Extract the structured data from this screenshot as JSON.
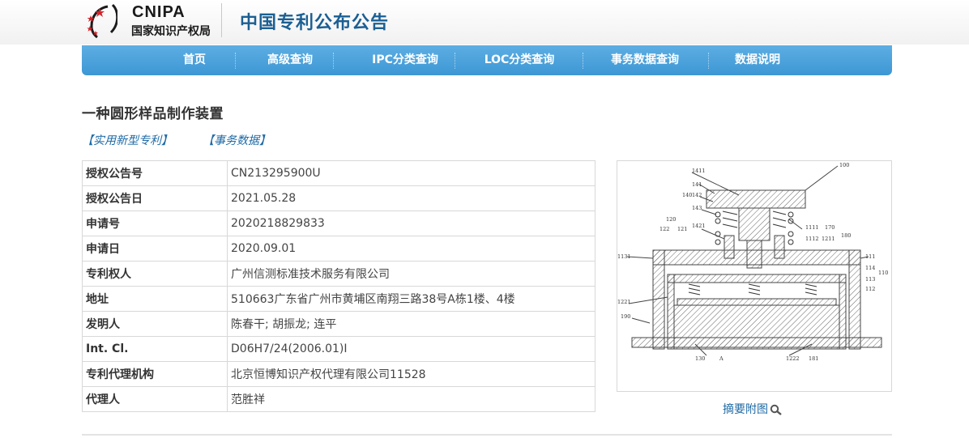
{
  "header": {
    "logo_text": "CNIPA",
    "logo_cn": "国家知识产权局",
    "site_title": "中国专利公布公告"
  },
  "nav": {
    "items": [
      "首页",
      "高级查询",
      "IPC分类查询",
      "LOC分类查询",
      "事务数据查询",
      "数据说明"
    ]
  },
  "patent": {
    "title": "一种圆形样品制作装置",
    "tags": [
      "【实用新型专利】",
      "【事务数据】"
    ],
    "fields": [
      {
        "label": "授权公告号",
        "value": "CN213295900U"
      },
      {
        "label": "授权公告日",
        "value": "2021.05.28"
      },
      {
        "label": "申请号",
        "value": "2020218829833"
      },
      {
        "label": "申请日",
        "value": "2020.09.01"
      },
      {
        "label": "专利权人",
        "value": "广州信测标准技术服务有限公司"
      },
      {
        "label": "地址",
        "value": "510663广东省广州市黄埔区南翔三路38号A栋1楼、4楼"
      },
      {
        "label": "发明人",
        "value": "陈春干; 胡振龙; 连平"
      },
      {
        "label": "Int. Cl.",
        "value": "D06H7/24(2006.01)I"
      },
      {
        "label": "专利代理机构",
        "value": "北京恒博知识产权代理有限公司11528"
      },
      {
        "label": "代理人",
        "value": "范胜祥"
      }
    ]
  },
  "figure": {
    "caption": "摘要附图",
    "labels": [
      "1411",
      "100",
      "141",
      "142",
      "140",
      "143",
      "1111",
      "170",
      "120",
      "122",
      "121",
      "1421",
      "1112",
      "1211",
      "180",
      "1131",
      "111",
      "114",
      "110",
      "113",
      "112",
      "1221",
      "190",
      "130",
      "A",
      "1222",
      "181"
    ]
  }
}
